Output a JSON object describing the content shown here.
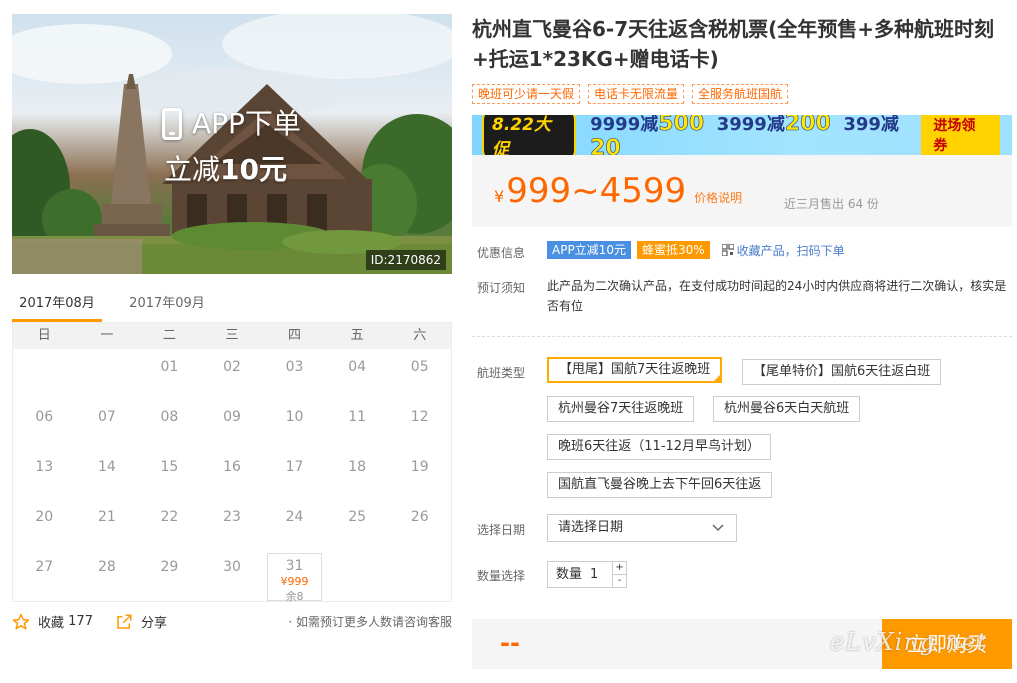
{
  "hero": {
    "promo_line1": "APP下单",
    "promo_line2_prefix": "立减",
    "promo_line2_amount": "10元",
    "id_tag": "ID:2170862"
  },
  "calendar": {
    "tabs": [
      {
        "label": "2017年08月",
        "active": true
      },
      {
        "label": "2017年09月",
        "active": false
      }
    ],
    "weekdays": [
      "日",
      "一",
      "二",
      "三",
      "四",
      "五",
      "六"
    ],
    "days": [
      "",
      "",
      "01",
      "02",
      "03",
      "04",
      "05",
      "06",
      "07",
      "08",
      "09",
      "10",
      "11",
      "12",
      "13",
      "14",
      "15",
      "16",
      "17",
      "18",
      "19",
      "20",
      "21",
      "22",
      "23",
      "24",
      "25",
      "26",
      "27",
      "28",
      "29",
      "30",
      "31",
      "",
      ""
    ],
    "available": {
      "day": "31",
      "price": "¥999",
      "remain": "余8"
    }
  },
  "actions": {
    "favorite_label": "收藏",
    "favorite_count": "177",
    "share_label": "分享",
    "consult_text": "· 如需预订更多人数请咨询客服"
  },
  "product": {
    "title": "杭州直飞曼谷6-7天往返含税机票(全年预售+多种航班时刻+托运1*23KG+赠电话卡)",
    "tags": [
      "晚班可少请一天假",
      "电话卡无限流量",
      "全服务航班国航"
    ]
  },
  "banner": {
    "badge": "8.22大促",
    "offers": [
      {
        "pre": "9999减",
        "amt": "500"
      },
      {
        "pre": "3999减",
        "amt": "200"
      },
      {
        "pre": "399减",
        "amt": "20"
      }
    ],
    "button": "进场领券",
    "colors": {
      "bg": "#9ee0ff",
      "badge_bg": "#1c1c1c",
      "accent": "#ffd200"
    }
  },
  "price": {
    "currency": "¥",
    "range": "999~4599",
    "note": "价格说明",
    "sold": "近三月售出 64 份"
  },
  "perks": {
    "label": "优惠信息",
    "app": "APP立减10元",
    "bee": "蜂蜜抵30%",
    "qr": "收藏产品，扫码下单"
  },
  "notice": {
    "label": "预订须知",
    "text": "此产品为二次确认产品，在支付成功时间起的24小时内供应商将进行二次确认，核实是否有位"
  },
  "flight": {
    "label": "航班类型",
    "options": [
      "【甩尾】国航7天往返晚班",
      "【尾单特价】国航6天往返白班",
      "杭州曼谷7天往返晚班",
      "杭州曼谷6天白天航班",
      "晚班6天往返（11-12月早鸟计划）",
      "国航直飞曼谷晚上去下午回6天往返"
    ]
  },
  "date": {
    "label": "选择日期",
    "placeholder": "请选择日期"
  },
  "quantity": {
    "label": "数量选择",
    "prefix": "数量",
    "value": "1",
    "plus": "+",
    "minus": "-"
  },
  "buy": {
    "total": "--",
    "button": "立即购买"
  },
  "watermark": "eLvXing.net",
  "colors": {
    "accent": "#ff9900",
    "price": "#ff6600",
    "link": "#4a7bc9"
  }
}
